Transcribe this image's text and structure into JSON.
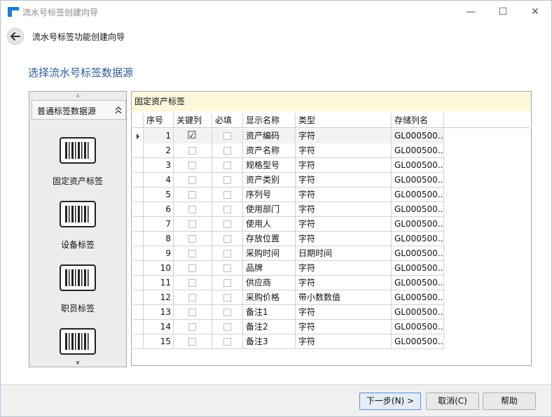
{
  "window": {
    "title": "流水号标签创建向导",
    "minimize_glyph": "—",
    "maximize_glyph": "☐",
    "close_glyph": "✕"
  },
  "nav": {
    "title": "流水号标签功能创建向导"
  },
  "page": {
    "heading": "选择流水号标签数据源"
  },
  "sources": {
    "group_label": "普通标签数据源",
    "items": [
      {
        "label": "固定资产标签"
      },
      {
        "label": "设备标签"
      },
      {
        "label": "职员标签"
      }
    ]
  },
  "panel": {
    "title": "固定资产标签"
  },
  "grid": {
    "headers": {
      "seq": "序号",
      "key": "关键列",
      "required": "必填",
      "display_name": "显示名称",
      "type": "类型",
      "storage_col": "存储列名"
    },
    "rows": [
      {
        "seq": "1",
        "key": true,
        "required": false,
        "name": "资产编码",
        "type": "字符",
        "col": "GL000500...",
        "selected": true
      },
      {
        "seq": "2",
        "key": false,
        "required": false,
        "name": "资产名称",
        "type": "字符",
        "col": "GL000500..."
      },
      {
        "seq": "3",
        "key": false,
        "required": false,
        "name": "规格型号",
        "type": "字符",
        "col": "GL000500..."
      },
      {
        "seq": "4",
        "key": false,
        "required": false,
        "name": "资产类别",
        "type": "字符",
        "col": "GL000500..."
      },
      {
        "seq": "5",
        "key": false,
        "required": false,
        "name": "序列号",
        "type": "字符",
        "col": "GL000500..."
      },
      {
        "seq": "6",
        "key": false,
        "required": false,
        "name": "使用部门",
        "type": "字符",
        "col": "GL000500..."
      },
      {
        "seq": "7",
        "key": false,
        "required": false,
        "name": "使用人",
        "type": "字符",
        "col": "GL000500..."
      },
      {
        "seq": "8",
        "key": false,
        "required": false,
        "name": "存放位置",
        "type": "字符",
        "col": "GL000500..."
      },
      {
        "seq": "9",
        "key": false,
        "required": false,
        "name": "采购时间",
        "type": "日期时间",
        "col": "GL000500..."
      },
      {
        "seq": "10",
        "key": false,
        "required": false,
        "name": "品牌",
        "type": "字符",
        "col": "GL000500..."
      },
      {
        "seq": "11",
        "key": false,
        "required": false,
        "name": "供应商",
        "type": "字符",
        "col": "GL000500..."
      },
      {
        "seq": "12",
        "key": false,
        "required": false,
        "name": "采购价格",
        "type": "带小数数值",
        "col": "GL000500..."
      },
      {
        "seq": "13",
        "key": false,
        "required": false,
        "name": "备注1",
        "type": "字符",
        "col": "GL000500..."
      },
      {
        "seq": "14",
        "key": false,
        "required": false,
        "name": "备注2",
        "type": "字符",
        "col": "GL000500..."
      },
      {
        "seq": "15",
        "key": false,
        "required": false,
        "name": "备注3",
        "type": "字符",
        "col": "GL000500..."
      }
    ]
  },
  "footer": {
    "next_label": "下一步(N) >",
    "cancel_label": "取消(C)",
    "help_label": "帮助"
  },
  "colors": {
    "heading": "#2c5e96",
    "panel_header_bg": "#fdf7db",
    "accent": "#1e7bd6"
  }
}
